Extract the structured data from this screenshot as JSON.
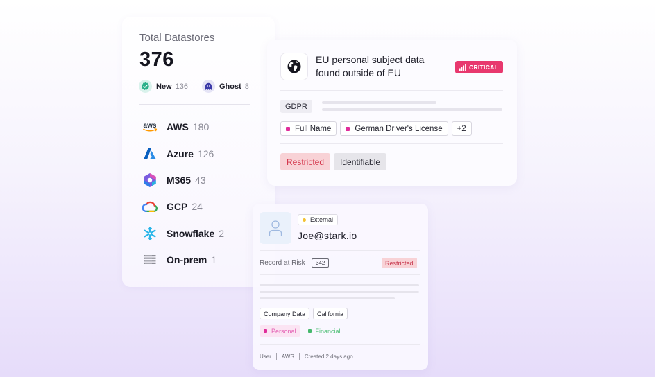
{
  "datastores": {
    "title": "Total Datastores",
    "total": "376",
    "stats": [
      {
        "label": "New",
        "count": "136",
        "icon": "check-badge-icon"
      },
      {
        "label": "Ghost",
        "count": "8",
        "icon": "ghost-icon"
      }
    ],
    "items": [
      {
        "name": "AWS",
        "count": "180",
        "icon": "aws-logo"
      },
      {
        "name": "Azure",
        "count": "126",
        "icon": "azure-logo"
      },
      {
        "name": "M365",
        "count": "43",
        "icon": "m365-logo"
      },
      {
        "name": "GCP",
        "count": "24",
        "icon": "gcp-logo"
      },
      {
        "name": "Snowflake",
        "count": "2",
        "icon": "snowflake-logo"
      },
      {
        "name": "On-prem",
        "count": "1",
        "icon": "server-icon"
      }
    ],
    "aws_logo_text": "aws"
  },
  "finding": {
    "title_line1": "EU personal subject data",
    "title_line2": "found outside of EU",
    "severity": "CRITICAL",
    "severity_color": "#e8386e",
    "regulation": "GDPR",
    "chips": [
      "Full Name",
      "German Driver's License",
      "+2"
    ],
    "tags": [
      "Restricted",
      "Identifiable"
    ]
  },
  "identity": {
    "badge": "External",
    "email": "Joe@stark.io",
    "risk_label": "Record at Risk",
    "risk_count": "342",
    "risk_tag": "Restricted",
    "meta_chips": [
      "Company Data",
      "California"
    ],
    "categories": [
      "Personal",
      "Financial"
    ],
    "footer": [
      "User",
      "AWS",
      "Created 2 days ago"
    ]
  },
  "colors": {
    "accent_pink": "#e02d9b",
    "restricted_bg": "#f8d2d6",
    "new_green": "#2bb08a",
    "ghost_indigo": "#3b3aa8"
  }
}
